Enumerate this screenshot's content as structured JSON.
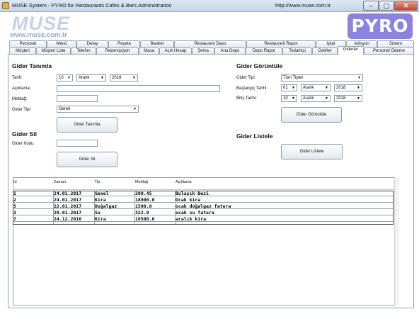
{
  "window": {
    "title": "MUSE System - PYRO for Restaurants Cafes & Bars Administration",
    "url": "http://www.muse.com.tr",
    "minimize": "‒",
    "maximize": "▢",
    "close": "✕"
  },
  "header": {
    "logo": "MUSE",
    "logo_url": "www.muse.com.tr",
    "badge": "PYRO"
  },
  "tabs_row1": [
    "Personel",
    "Menü",
    "Detay",
    "Reçete",
    "Banket",
    "Restaurant Depo",
    "Restaurant Rapor",
    "İptal",
    "Adisyon",
    "Sistem"
  ],
  "tabs_row2": [
    "Müşteri",
    "Müşteri Liste",
    "Telefon",
    "Rezervasyon",
    "Masa",
    "Açık Hesap",
    "Şema",
    "Ana Depo",
    "Depo Rapor",
    "Tedarikçi",
    "Gelirler",
    "Giderler",
    "Personel Ödeme"
  ],
  "active_tab": "Giderler",
  "gider_tanimla": {
    "title": "Gider Tanımla",
    "tarih_label": "Tarih:",
    "day": "10",
    "month": "Aralık",
    "year": "2018",
    "aciklama_label": "Açıklama:",
    "aciklama_value": "",
    "meblag_label": "Meblağ:",
    "meblag_value": "",
    "tip_label": "Gider Tipi:",
    "tip_value": "Genel",
    "button": "Gider Tanımla"
  },
  "gider_sil": {
    "title": "Gider Sil",
    "kod_label": "Gider Kodu:",
    "kod_value": "",
    "button": "Gider Sil"
  },
  "gider_goruntule": {
    "title": "Gider Görüntüle",
    "tip_label": "Gider Tipi:",
    "tip_value": "Tüm Tipler",
    "baslangic_label": "Başlangıç Tarihi:",
    "baslangic_day": "01",
    "baslangic_month": "Aralık",
    "baslangic_year": "2018",
    "bitis_label": "Bitiş Tarihi:",
    "bitis_day": "10",
    "bitis_month": "Aralık",
    "bitis_year": "2018",
    "button": "Gider Görüntüle"
  },
  "gider_listele": {
    "title": "Gider Listele",
    "button": "Gider Listele"
  },
  "table": {
    "headers": [
      "Id",
      "Zaman",
      "Tip",
      "Meblağ",
      "Açıklama"
    ],
    "rows": [
      [
        "1",
        "24.01.2017",
        "Genel",
        "200.45",
        "Bulaşık Bezi"
      ],
      [
        "2",
        "24.01.2017",
        "Kira",
        "18000.0",
        "Ocak kira"
      ],
      [
        "5",
        "22.01.2017",
        "Doğalgaz",
        "1500.0",
        "ocak doğalgaz fatura"
      ],
      [
        "3",
        "20.01.2017",
        "Su",
        "322.0",
        "ocak su fatura"
      ],
      [
        "7",
        "24.12.2016",
        "Kira",
        "16500.0",
        "aralık kira"
      ]
    ]
  }
}
